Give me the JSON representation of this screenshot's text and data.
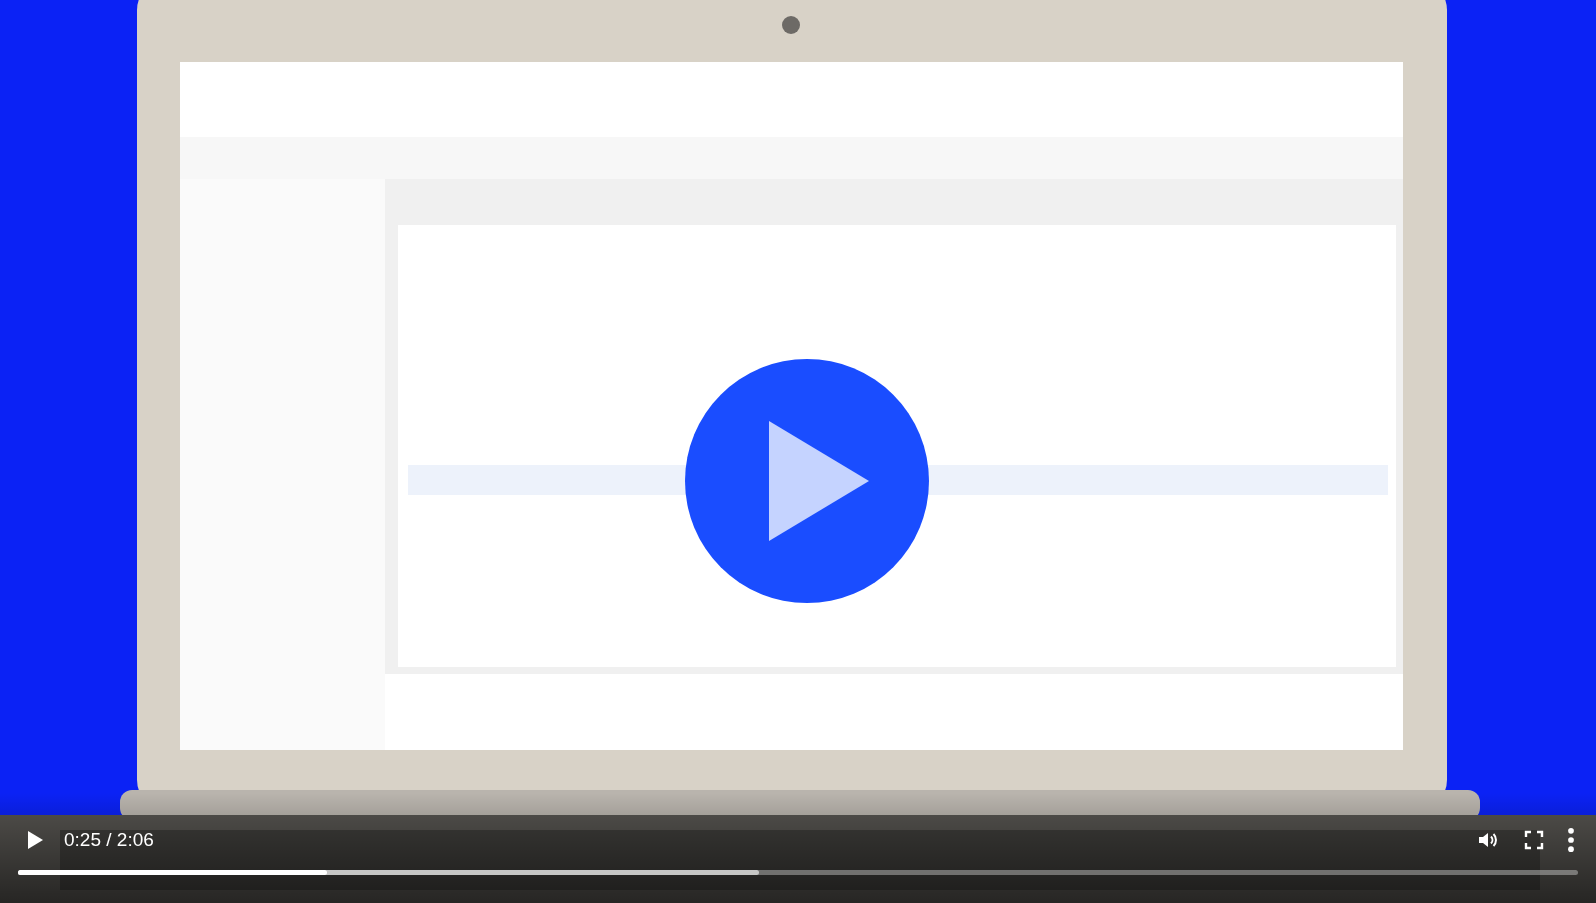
{
  "player": {
    "playing": false,
    "time": "0:25 / 2:06",
    "progress": {
      "level": 0.198
    },
    "buffered": {
      "level": 0.475
    }
  }
}
